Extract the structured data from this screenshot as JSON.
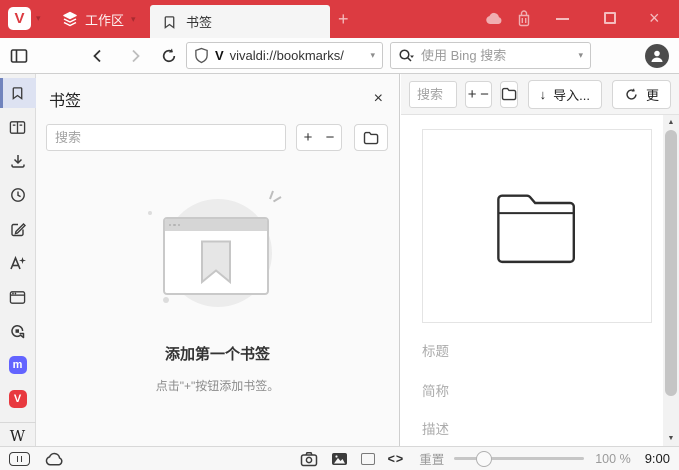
{
  "titlebar": {
    "menu_letter": "V",
    "workspace": "工作区",
    "tab": "书签"
  },
  "navbar": {
    "address": "vivaldi://bookmarks/",
    "address_badge": "V",
    "search_placeholder": "使用 Bing 搜索"
  },
  "sidebar": {
    "mastodon_glyph": "m",
    "vivaldi_glyph": "V",
    "wikipedia_glyph": "W"
  },
  "panel": {
    "title": "书签",
    "search_placeholder": "搜索",
    "empty_title": "添加第一个书签",
    "empty_hint": "点击\"+\"按钮添加书签。"
  },
  "page": {
    "search_placeholder": "搜索",
    "import_label": "导入...",
    "more_label": "更",
    "title_placeholder": "标题",
    "nickname_placeholder": "简称",
    "description_placeholder": "描述"
  },
  "statusbar": {
    "reset_label": "重置",
    "zoom_level": "100 %",
    "clock": "9:00"
  },
  "icons": {
    "plus": "+",
    "minus": "−",
    "close": "×",
    "caret_down": "▾",
    "new_tab": "+",
    "import_arrow": "↓",
    "code": "<>",
    "scroll_up": "▲",
    "scroll_down": "▼"
  },
  "colors": {
    "titlebar_red": "#dc3b41",
    "active_item_bg": "#dde2f2",
    "accent_bar": "#7083bd",
    "mastodon_purple": "#6364ff",
    "vivaldi_icon_red": "#e8393f"
  }
}
